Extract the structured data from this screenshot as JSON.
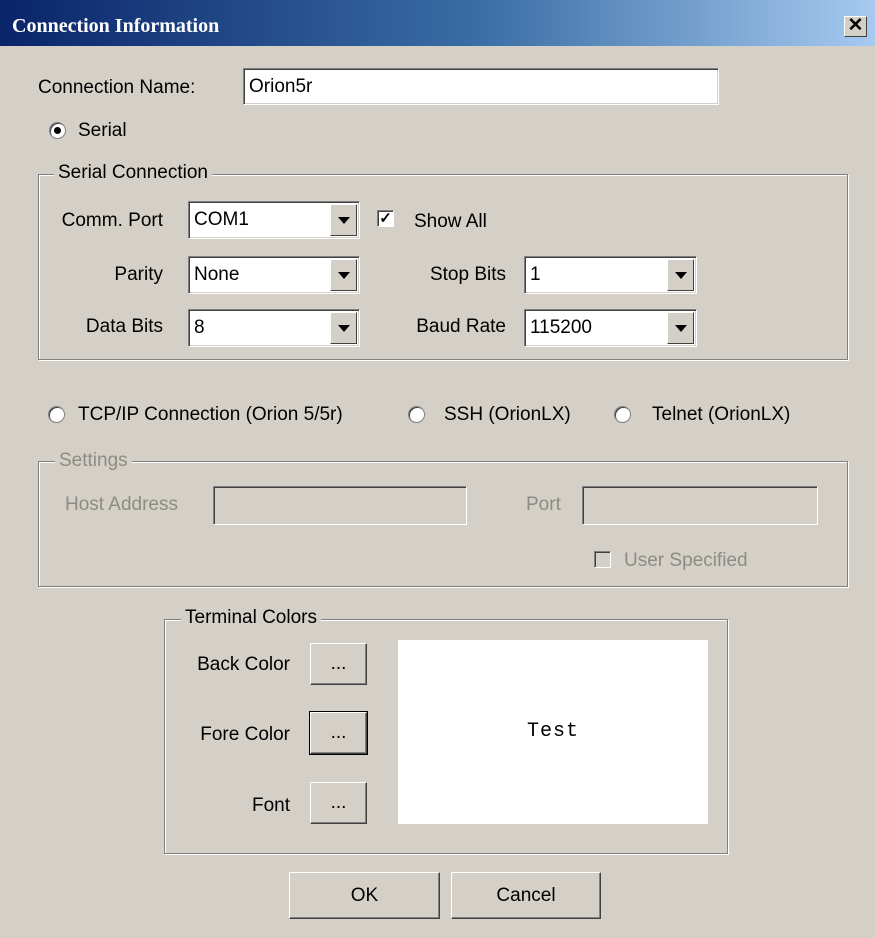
{
  "window": {
    "title": "Connection Information",
    "close_glyph": "✕"
  },
  "connection_name": {
    "label": "Connection Name:",
    "value": "Orion5r"
  },
  "serial_radio": {
    "label": "Serial",
    "selected": true
  },
  "serial_group": {
    "legend": "Serial Connection",
    "comm_port": {
      "label": "Comm. Port",
      "value": "COM1"
    },
    "show_all": {
      "label": "Show All",
      "checked": true
    },
    "parity": {
      "label": "Parity",
      "value": "None"
    },
    "stop_bits": {
      "label": "Stop Bits",
      "value": "1"
    },
    "data_bits": {
      "label": "Data Bits",
      "value": "8"
    },
    "baud_rate": {
      "label": "Baud Rate",
      "value": "115200"
    }
  },
  "connection_types": [
    {
      "label": "TCP/IP Connection (Orion 5/5r)",
      "selected": false
    },
    {
      "label": "SSH (OrionLX)",
      "selected": false
    },
    {
      "label": "Telnet (OrionLX)",
      "selected": false
    }
  ],
  "settings_group": {
    "legend": "Settings",
    "host_address_label": "Host Address",
    "host_address_value": "",
    "port_label": "Port",
    "port_value": "",
    "user_specified_label": "User Specified"
  },
  "terminal_colors": {
    "legend": "Terminal Colors",
    "back_color_label": "Back Color",
    "fore_color_label": "Fore Color",
    "font_label": "Font",
    "picker_button_label": "...",
    "preview_text": "Test"
  },
  "buttons": {
    "ok": "OK",
    "cancel": "Cancel"
  },
  "colors": {
    "dialog_bg": "#d4d0c8",
    "titlebar_start": "#0a246a",
    "titlebar_end": "#a6caf0",
    "disabled_text": "#8e8b84"
  }
}
